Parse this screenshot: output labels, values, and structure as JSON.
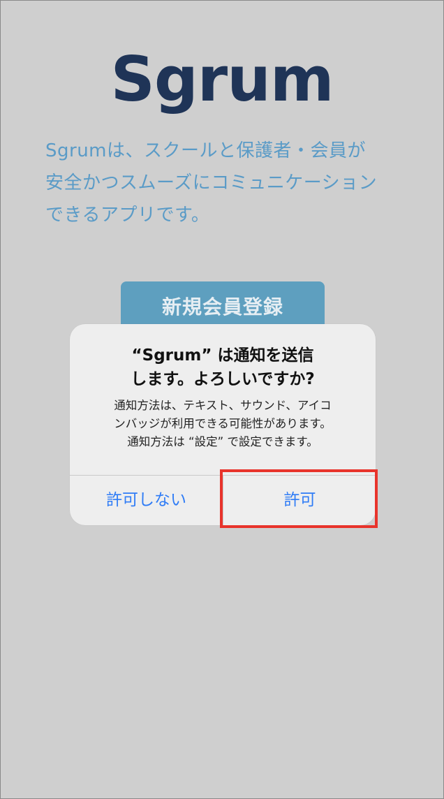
{
  "app": {
    "logo_text": "Sgrum",
    "tagline_lines": [
      "Sgrumは、スクールと保護者・会員が",
      "安全かつスムーズにコミュニケーション",
      "できるアプリです。"
    ],
    "register_label": "新規会員登録"
  },
  "alert": {
    "title_lines": [
      "“Sgrum” は通知を送信",
      "します。よろしいですか?"
    ],
    "message_lines": [
      "通知方法は、テキスト、サウンド、アイコ",
      "ンバッジが利用できる可能性があります。",
      "通知方法は “設定” で設定できます。"
    ],
    "deny_label": "許可しない",
    "allow_label": "許可"
  },
  "colors": {
    "background": "#cfcfcf",
    "logo": "#1f3457",
    "tagline": "#5a9bc7",
    "register_button": "#5e9fbf",
    "alert_button_text": "#2f7cf6",
    "highlight": "#e8332b"
  }
}
